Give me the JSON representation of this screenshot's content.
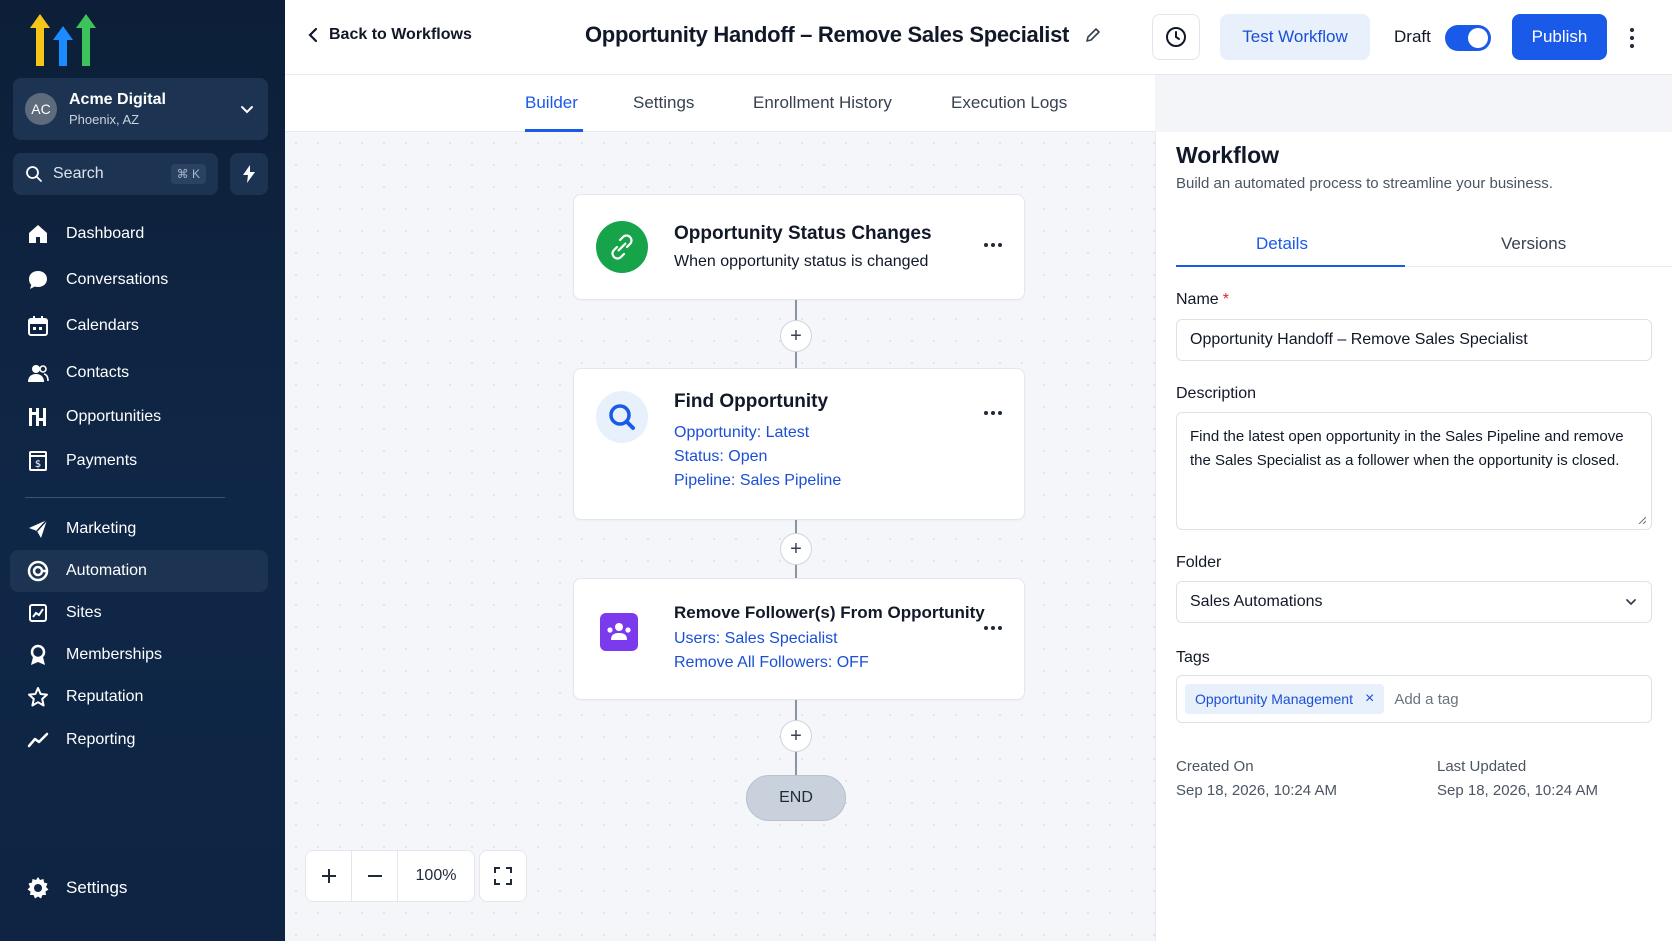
{
  "account": {
    "initials": "AC",
    "name": "Acme Digital",
    "location": "Phoenix, AZ"
  },
  "search": {
    "label": "Search",
    "shortcut": "⌘ K"
  },
  "nav": [
    {
      "label": "Dashboard",
      "icon": "home-icon"
    },
    {
      "label": "Conversations",
      "icon": "chat-icon"
    },
    {
      "label": "Calendars",
      "icon": "calendar-icon"
    },
    {
      "label": "Contacts",
      "icon": "contacts-icon"
    },
    {
      "label": "Opportunities",
      "icon": "opportunities-icon"
    },
    {
      "label": "Payments",
      "icon": "payments-icon"
    },
    {
      "label": "Marketing",
      "icon": "send-icon"
    },
    {
      "label": "Automation",
      "icon": "automation-icon",
      "active": true
    },
    {
      "label": "Sites",
      "icon": "sites-icon"
    },
    {
      "label": "Memberships",
      "icon": "memberships-icon"
    },
    {
      "label": "Reputation",
      "icon": "star-icon"
    },
    {
      "label": "Reporting",
      "icon": "reporting-icon"
    }
  ],
  "settings_label": "Settings",
  "topbar": {
    "back_label": "Back to Workflows",
    "title": "Opportunity Handoff – Remove Sales Specialist",
    "test_label": "Test Workflow",
    "draft_label": "Draft",
    "publish_label": "Publish"
  },
  "tabs": [
    "Builder",
    "Settings",
    "Enrollment History",
    "Execution Logs"
  ],
  "nodes": {
    "trigger": {
      "title": "Opportunity Status Changes",
      "lines": [
        "When opportunity status is changed"
      ]
    },
    "find": {
      "title": "Find Opportunity",
      "lines": [
        "Opportunity: Latest",
        "Status: Open",
        "Pipeline: Sales Pipeline"
      ]
    },
    "remove": {
      "title": "Remove Follower(s) From Opportunity",
      "lines": [
        "Users: Sales Specialist",
        "Remove All Followers: OFF"
      ]
    },
    "end_label": "END"
  },
  "zoom": {
    "value": "100%"
  },
  "panel": {
    "title": "Workflow",
    "subtitle": "Build an automated process to streamline your business.",
    "tabs": [
      "Details",
      "Versions"
    ],
    "name_label": "Name",
    "name_value": "Opportunity Handoff – Remove Sales Specialist",
    "description_label": "Description",
    "description_value": "Find the latest open opportunity in the Sales Pipeline and remove the Sales Specialist as a follower when the opportunity is closed.",
    "folder_label": "Folder",
    "folder_value": "Sales Automations",
    "tags_label": "Tags",
    "tags": [
      "Opportunity Management"
    ],
    "tag_placeholder": "Add a tag",
    "created_label": "Created On",
    "created_value": "Sep 18, 2026, 10:24 AM",
    "updated_label": "Last Updated",
    "updated_value": "Sep 18, 2026, 10:24 AM"
  },
  "colors": {
    "accent": "#1a5ae8",
    "sidebar": "#0f2747",
    "trigger_green": "#16a34a",
    "action_purple": "#7c3aed"
  }
}
